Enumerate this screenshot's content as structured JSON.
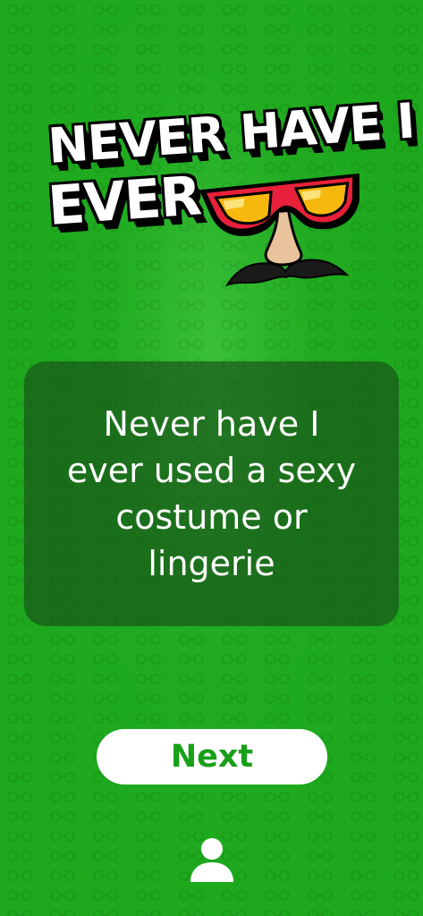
{
  "logo": {
    "line1": "NEVER HAVE I",
    "line2": "EVER"
  },
  "card": {
    "question": "Never have I ever used a sexy costume or lingerie"
  },
  "actions": {
    "next_label": "Next"
  },
  "icons": {
    "logo_art": "glasses-nose-mustache-icon",
    "bottom": "profile-icon",
    "background_pattern": "glasses-icon"
  },
  "colors": {
    "background": "#1da81d",
    "card": "#244f24",
    "button_text": "#18a018"
  }
}
